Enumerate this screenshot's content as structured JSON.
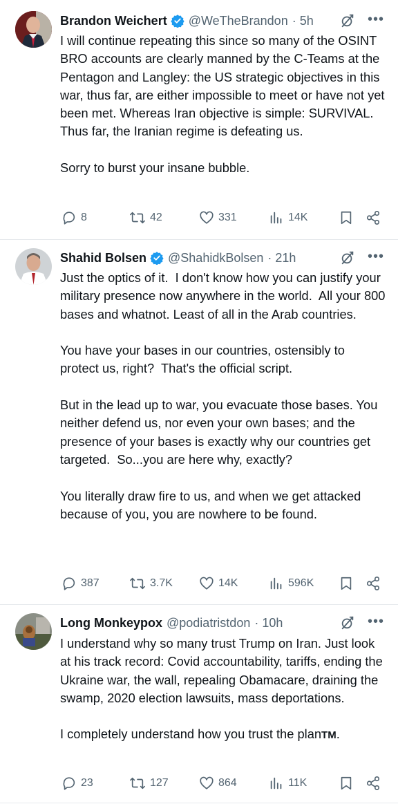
{
  "tweets": [
    {
      "author": "Brandon Weichert",
      "handle": "@WeTheBrandon",
      "time": "· 5h",
      "body": "I will continue repeating this since so many of the OSINT BRO accounts are clearly manned by the C-Teams at the Pentagon and Langley: the US strategic objectives in this war, thus far, are either impossible to meet or have not yet been met. Whereas Iran objective is simple: SURVIVAL. Thus far, the Iranian regime is defeating us.\n\nSorry to burst your insane bubble.",
      "replies": "8",
      "reposts": "42",
      "likes": "331",
      "views": "14K"
    },
    {
      "author": "Shahid Bolsen",
      "handle": "@ShahidkBolsen",
      "time": "· 21h",
      "body": "Just the optics of it.  I don't know how you can justify your military presence now anywhere in the world.  All your 800 bases and whatnot. Least of all in the Arab countries.\n\nYou have your bases in our countries, ostensibly to protect us, right?  That's the official script.\n\nBut in the lead up to war, you evacuate those bases. You neither defend us, nor even your own bases; and the presence of your bases is exactly why our countries get targeted.  So...you are here why, exactly?\n\nYou literally draw fire to us, and when we get attacked because of you, you are nowhere to be found.",
      "replies": "387",
      "reposts": "3.7K",
      "likes": "14K",
      "views": "596K"
    },
    {
      "author": "Long Monkeypox",
      "handle": "@podiatristdon",
      "time": "· 10h",
      "body": "I understand why so many trust Trump on Iran. Just look at his track record: Covid accountability, tariffs, ending the Ukraine war, the wall, repealing Obamacare, draining the swamp, 2020 election lawsuits, mass deportations.\n\nI completely understand how you trust the plan",
      "body_suffix": "TM",
      "body_end": ".",
      "replies": "23",
      "reposts": "127",
      "likes": "864",
      "views": "11K"
    }
  ],
  "icons": {
    "verified": "verified-badge-icon",
    "grok": "grok-icon",
    "more": "more-icon",
    "reply": "reply-icon",
    "repost": "repost-icon",
    "like": "heart-icon",
    "views": "views-icon",
    "bookmark": "bookmark-icon",
    "share": "share-icon"
  },
  "more_glyph": "•••",
  "colors": {
    "text": "#0f1419",
    "muted": "#536471",
    "verified": "#1d9bf0",
    "divider": "#e6e9ec"
  }
}
